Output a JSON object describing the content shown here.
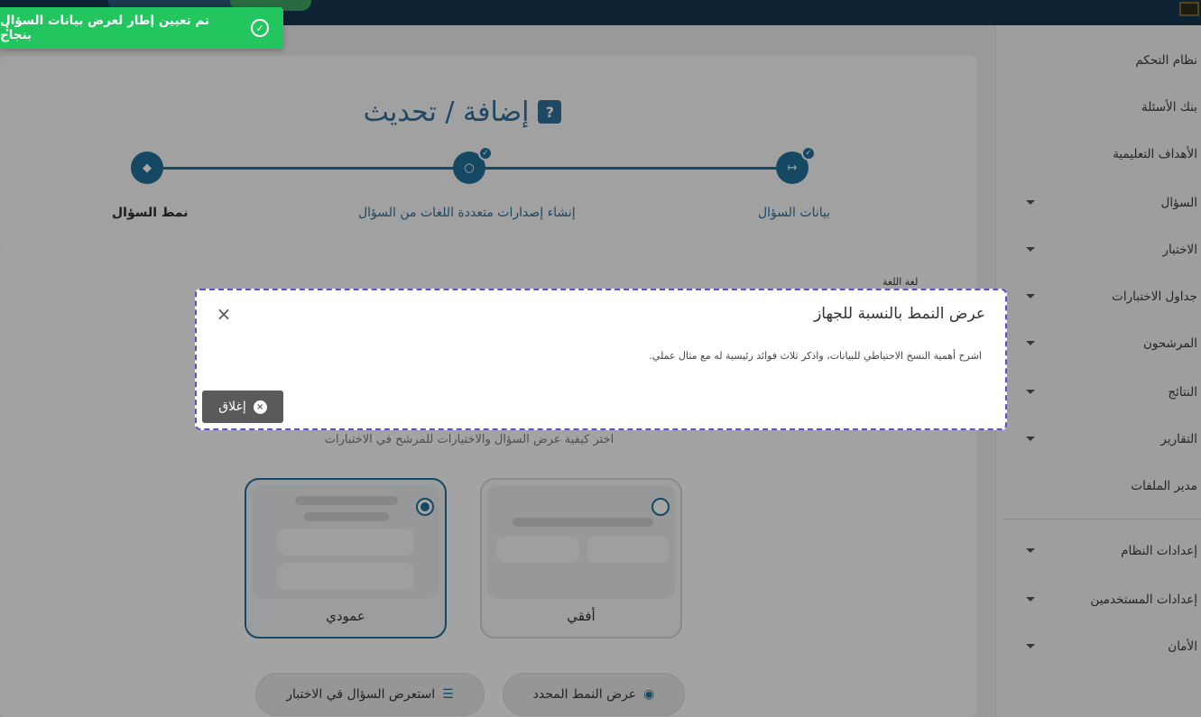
{
  "toast": {
    "message": "تم تعيين إطار لعرض بيانات السؤال بنجاح"
  },
  "sidebar": {
    "items": [
      {
        "label": "نظام التحكم"
      },
      {
        "label": "بنك الأسئلة"
      },
      {
        "label": "الأهداف التعليمية"
      },
      {
        "label": "السؤال"
      },
      {
        "label": "الاختبار"
      },
      {
        "label": "جداول الاختبارات"
      },
      {
        "label": "المرشحون"
      },
      {
        "label": "النتائج"
      },
      {
        "label": "التقارير"
      },
      {
        "label": "مدير الملفات"
      },
      {
        "label": "إعدادات النظام"
      },
      {
        "label": "إعدادات المستخدمين"
      },
      {
        "label": "الأمان"
      }
    ]
  },
  "page": {
    "title": "إضافة / تحديث",
    "steps": [
      {
        "label": "بيانات السؤال",
        "icon": "arrow-right-to-line-icon"
      },
      {
        "label": "إنشاء إصدارات متعددة اللغات من السؤال",
        "icon": "globe-icon"
      },
      {
        "label": "نمط السؤال",
        "icon": "layers-icon"
      }
    ],
    "lang_label": "لغة اللغة",
    "hint": "اختر كيفية عرض السؤال والاختيارات للمرشح في الاختبارات",
    "options": [
      {
        "label": "عمودي",
        "selected": true
      },
      {
        "label": "أفقي",
        "selected": false
      }
    ],
    "buttons": {
      "preview_question": "استعرض السؤال في الاختبار",
      "view_selected": "عرض النمط المحدد"
    }
  },
  "modal": {
    "title": "عرض النمط بالنسبة للجهاز",
    "body": "اشرح أهمية النسخ الاحتياطي للبيانات، واذكر ثلاث فوائد رئيسية له مع مثال عملي.",
    "close_label": "إغلاق"
  },
  "colors": {
    "accent": "#1f6f98",
    "toast": "#22c55e",
    "modal_border": "#5b4fd6"
  }
}
